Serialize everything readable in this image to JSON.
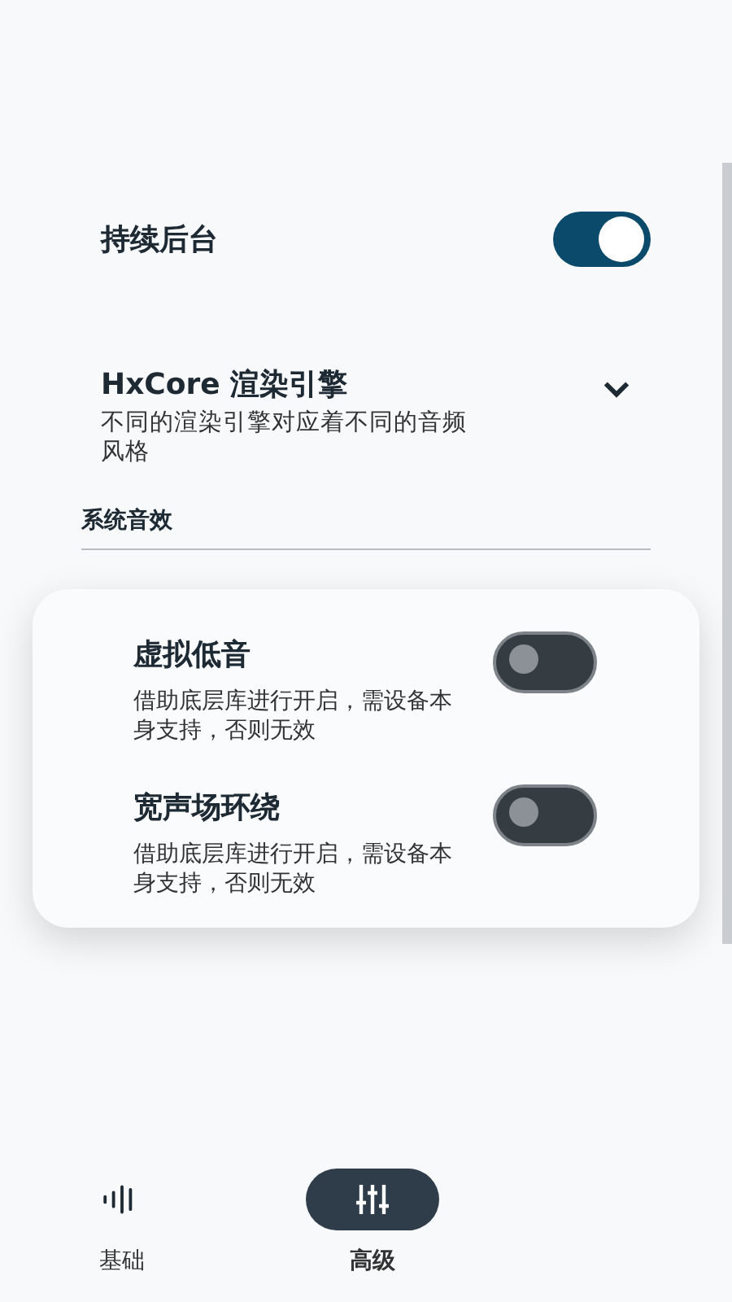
{
  "settings": [
    {
      "kind": "switch",
      "title": "持续后台",
      "on": true
    },
    {
      "kind": "dropdown",
      "title": "HxCore 渲染引擎",
      "description": "不同的渲染引擎对应着不同的音频风格",
      "expanded": false
    }
  ],
  "section": {
    "title": "系统音效"
  },
  "card_items": [
    {
      "title": "虚拟低音",
      "description": "借助底层库进行开启，需设备本身支持，否则无效",
      "on": false
    },
    {
      "title": "宽声场环绕",
      "description": "借助底层库进行开启，需设备本身支持，否则无效",
      "on": false
    }
  ],
  "nav": [
    {
      "kind": "waves",
      "label": "基础",
      "selected": false
    },
    {
      "kind": "sliders",
      "label": "高级",
      "selected": true
    }
  ]
}
